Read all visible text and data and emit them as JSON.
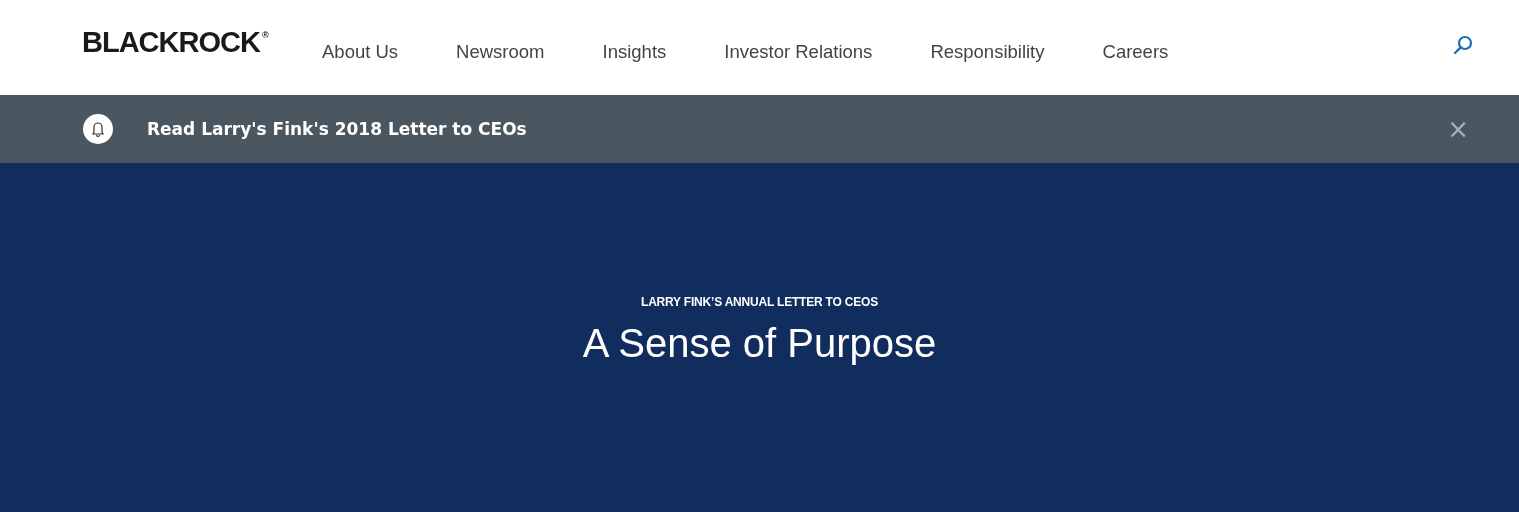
{
  "header": {
    "logo": "BLACKROCK$^{®}$",
    "nav": [
      {
        "label": "About Us"
      },
      {
        "label": "Newsroom"
      },
      {
        "label": "Insights"
      },
      {
        "label": "Investor Relations"
      },
      {
        "label": "Responsibility"
      },
      {
        "label": "Careers"
      }
    ]
  },
  "banner": {
    "text": "Read Larry's Fink's 2018 Letter to CEOs",
    "close": "×"
  },
  "hero": {
    "eyebrow": "LARRY FINK’S ANNUAL LETTER TO CEOS",
    "title": "A Sense of Purpose"
  }
}
